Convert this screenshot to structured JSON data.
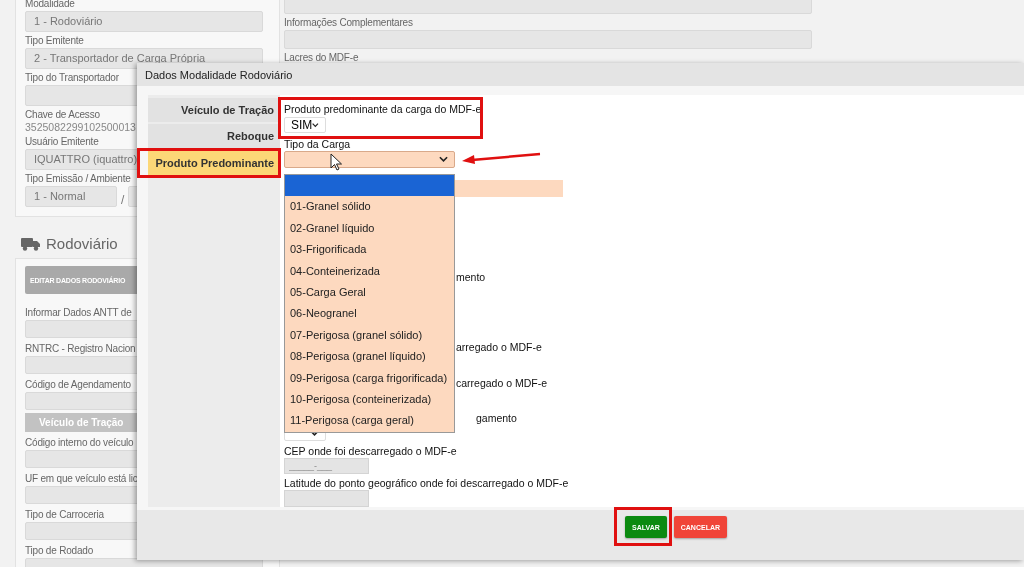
{
  "page": {
    "left_fields": [
      {
        "kind": "field",
        "label": "Modalidade",
        "value": "1 - Rodoviário"
      },
      {
        "kind": "field",
        "label": "Tipo Emitente",
        "value": "2 - Transportador de Carga Própria"
      },
      {
        "kind": "field",
        "label": "Tipo do Transportador"
      },
      {
        "kind": "text",
        "label": "Chave de Acesso",
        "value": "3525082299102500013"
      },
      {
        "kind": "field",
        "label": "Usuário Emitente",
        "value": "IQUATTRO (iquattro)"
      },
      {
        "kind": "pair",
        "label": "Tipo Emissão / Ambiente",
        "value": "1 - Normal",
        "separator": "/"
      }
    ],
    "section_title": "Rodoviário",
    "edit_button": "EDITAR DADOS RODOVIÁRIO",
    "section_fields": [
      {
        "kind": "field",
        "label": "Informar Dados ANTT de"
      },
      {
        "kind": "field",
        "label": "RNTRC - Registro Nacion"
      },
      {
        "kind": "field",
        "label": "Código de Agendamento"
      },
      {
        "kind": "header",
        "label": "Veículo de Tração"
      },
      {
        "kind": "field",
        "label": "Código interno do veículo"
      },
      {
        "kind": "field",
        "label": "UF em que veículo está lic"
      },
      {
        "kind": "field",
        "label": "Tipo de Carroceria"
      },
      {
        "kind": "field",
        "label": "Tipo de Rodado"
      }
    ],
    "right_fields": [
      {
        "kind": "field"
      },
      {
        "kind": "field",
        "label": "Informações Complementares"
      },
      {
        "kind": "label",
        "label": "Lacres do MDF-e"
      }
    ]
  },
  "modal": {
    "title": "Dados Modalidade Rodoviário",
    "tabs": [
      {
        "label": "Veículo de Tração",
        "selected": false
      },
      {
        "label": "Reboque",
        "selected": false
      },
      {
        "label": "Produto Predominante",
        "selected": true
      }
    ],
    "produto_label": "Produto predominante da carga do MDF-e",
    "produto_value": "SIM",
    "tipo_label": "Tipo da Carga",
    "options": [
      {
        "selected": true
      },
      {
        "label": "01-Granel sólido",
        "selected": false
      },
      {
        "label": "02-Granel líquido",
        "selected": false
      },
      {
        "label": "03-Frigorificada",
        "selected": false
      },
      {
        "label": "04-Conteinerizada",
        "selected": false
      },
      {
        "label": "05-Carga Geral",
        "selected": false
      },
      {
        "label": "06-Neogranel",
        "selected": false
      },
      {
        "label": "07-Perigosa (granel sólido)",
        "selected": false
      },
      {
        "label": "08-Perigosa (granel líquido)",
        "selected": false
      },
      {
        "label": "09-Perigosa (carga frigorificada)",
        "selected": false
      },
      {
        "label": "10-Perigosa (conteinerizada)",
        "selected": false
      },
      {
        "label": "11-Perigosa (carga geral)",
        "selected": false
      }
    ],
    "fragments": [
      "mento",
      "arregado o MDF-e",
      "carregado o MDF-e",
      "gamento"
    ],
    "cep_label": "CEP onde foi descarregado o MDF-e",
    "cep_placeholder": "_____-___",
    "latitude_label": "Latitude do ponto geográfico onde foi descarregado o MDF-e",
    "buttons": [
      {
        "label": "SALVAR",
        "kind": "primary"
      },
      {
        "label": "CANCELAR",
        "kind": "danger"
      }
    ]
  }
}
